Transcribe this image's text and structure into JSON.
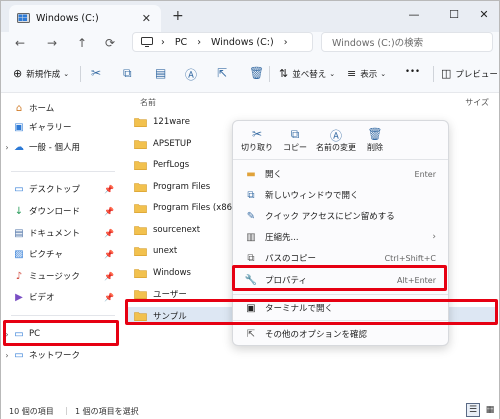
{
  "window": {
    "tab_title": "Windows (C:)",
    "new_tab": "+",
    "close_tab": "✕",
    "controls": {
      "minimize": "—",
      "maximize": "☐",
      "close": "✕"
    }
  },
  "nav": {
    "back": "←",
    "forward": "→",
    "up": "↑",
    "refresh": "⟳",
    "breadcrumb": [
      "PC",
      "Windows (C:)"
    ],
    "breadcrumb_sep": "›",
    "search_placeholder": "Windows (C:)の検索"
  },
  "toolbar": {
    "new_label": "新規作成",
    "sort_label": "並べ替え",
    "view_label": "表示",
    "more": "•••",
    "preview_label": "プレビュー"
  },
  "sidebar": {
    "items": [
      {
        "label": "ホーム",
        "icon": "home-icon",
        "glyph": "⌂",
        "chev": ""
      },
      {
        "label": "ギャラリー",
        "icon": "gallery-icon",
        "glyph": "▣",
        "chev": ""
      },
      {
        "label": "一般 - 個人用",
        "icon": "cloud-icon",
        "glyph": "☁",
        "chev": "›"
      },
      {
        "label": "デスクトップ",
        "icon": "desktop-icon",
        "glyph": "▭",
        "chev": ""
      },
      {
        "label": "ダウンロード",
        "icon": "download-icon",
        "glyph": "↓",
        "chev": ""
      },
      {
        "label": "ドキュメント",
        "icon": "document-icon",
        "glyph": "▤",
        "chev": ""
      },
      {
        "label": "ピクチャ",
        "icon": "pictures-icon",
        "glyph": "▨",
        "chev": ""
      },
      {
        "label": "ミュージック",
        "icon": "music-icon",
        "glyph": "♪",
        "chev": ""
      },
      {
        "label": "ビデオ",
        "icon": "video-icon",
        "glyph": "▶",
        "chev": ""
      },
      {
        "label": "PC",
        "icon": "pc-icon",
        "glyph": "▭",
        "chev": "›"
      },
      {
        "label": "ネットワーク",
        "icon": "network-icon",
        "glyph": "▭",
        "chev": "›"
      }
    ]
  },
  "files": {
    "column_name": "名前",
    "column_size": "サイズ",
    "items": [
      "121ware",
      "APSETUP",
      "PerfLogs",
      "Program Files",
      "Program Files (x86)",
      "sourcenext",
      "unext",
      "Windows",
      "ユーザー",
      "サンプル"
    ]
  },
  "context_menu": {
    "quick_actions": [
      {
        "label": "切り取り",
        "icon": "scissors-icon",
        "glyph": "✂"
      },
      {
        "label": "コピー",
        "icon": "copy-icon",
        "glyph": "⧉"
      },
      {
        "label": "名前の変更",
        "icon": "rename-icon",
        "glyph": "Ⓐ"
      },
      {
        "label": "削除",
        "icon": "trash-icon",
        "glyph": "🗑"
      }
    ],
    "items": [
      {
        "label": "開く",
        "shortcut": "Enter",
        "icon": "folder-open-icon",
        "glyph": "▬"
      },
      {
        "label": "新しいウィンドウで開く",
        "shortcut": "",
        "icon": "new-window-icon",
        "glyph": "⧉"
      },
      {
        "label": "クイック アクセスにピン留めする",
        "shortcut": "",
        "icon": "pin-icon",
        "glyph": "✎"
      },
      {
        "label": "圧縮先...",
        "shortcut": "",
        "icon": "zip-icon",
        "glyph": "▥"
      },
      {
        "label": "パスのコピー",
        "shortcut": "Ctrl+Shift+C",
        "icon": "copy-path-icon",
        "glyph": "⧉"
      },
      {
        "label": "プロパティ",
        "shortcut": "Alt+Enter",
        "icon": "wrench-icon",
        "glyph": "🔧"
      },
      {
        "label": "ターミナルで開く",
        "shortcut": "",
        "icon": "terminal-icon",
        "glyph": "▣"
      },
      {
        "label": "その他のオプションを確認",
        "shortcut": "",
        "icon": "more-options-icon",
        "glyph": "⇱"
      }
    ],
    "submenu_arrow": "›"
  },
  "status": {
    "item_count": "10 個の項目",
    "selected": "1 個の項目を選択"
  },
  "colors": {
    "highlight": "#e60012",
    "accent": "#3a6ea5",
    "folder": "#f2c14e",
    "selected_row": "#dde7f3"
  }
}
